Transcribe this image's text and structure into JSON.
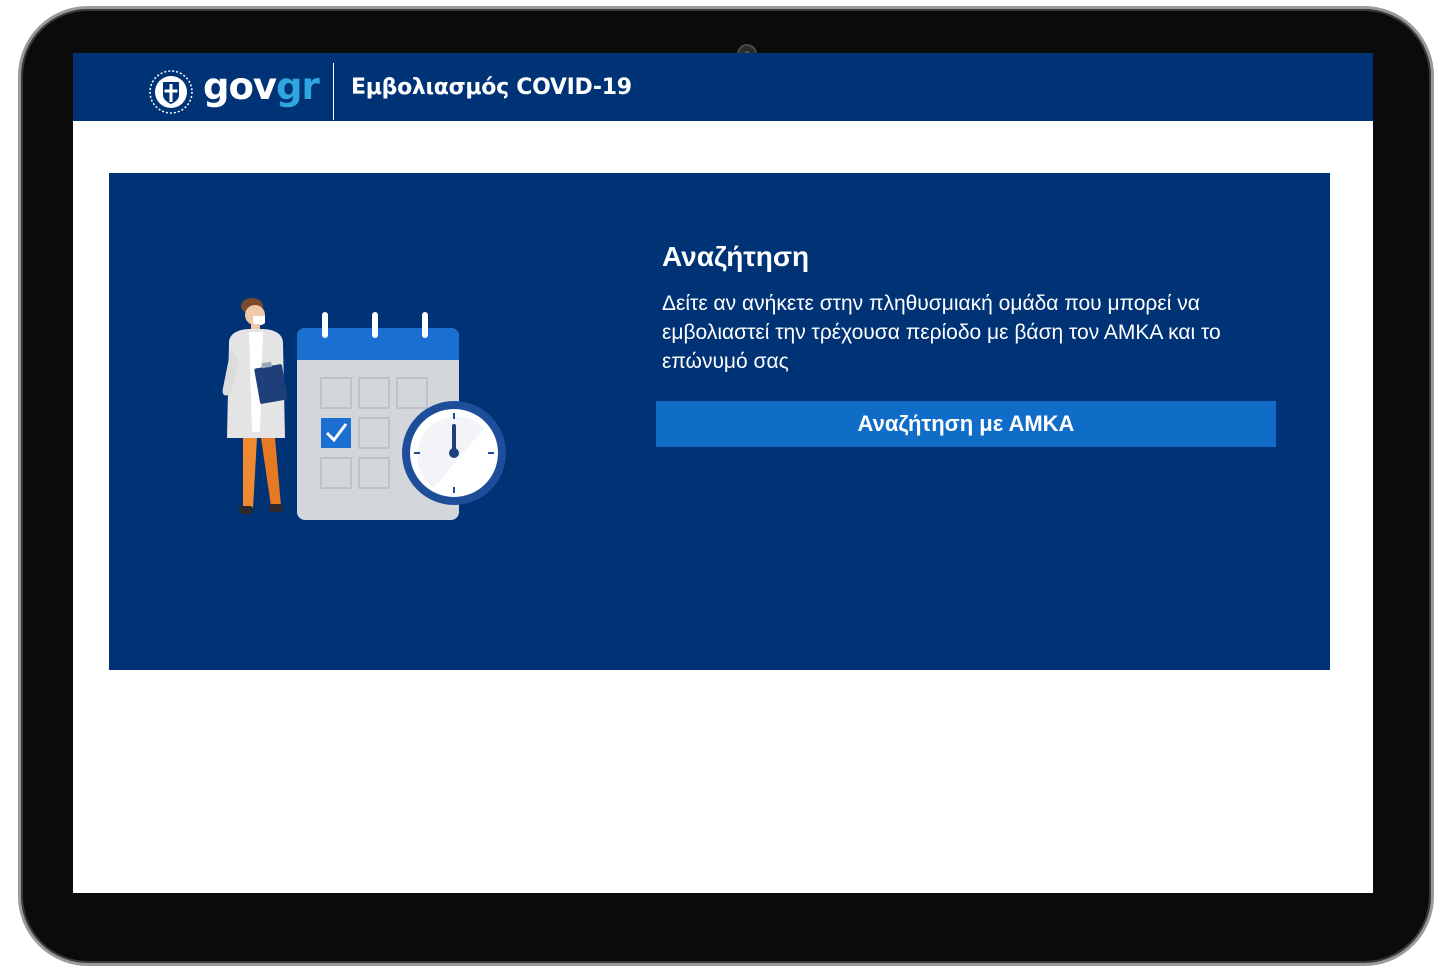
{
  "header": {
    "brand_gov": "gov",
    "brand_gr": "gr",
    "service_name": "Εμβολιασμός COVID-19",
    "emblem_icon": "hellenic-emblem-icon",
    "background_color": "#003375",
    "brand_accent_color": "#2fa6e0"
  },
  "panel": {
    "title": "Αναζήτηση",
    "description": "Δείτε αν ανήκετε στην πληθυσμιακή ομάδα που μπορεί να εμβολιαστεί την τρέχουσα περίοδο με βάση τον ΑΜΚΑ και το επώνυμό σας",
    "button_label": "Αναζήτηση με ΑΜΚΑ",
    "illustration_icons": [
      "doctor-icon",
      "calendar-icon",
      "clock-icon"
    ],
    "background_color": "#003375",
    "button_color": "#0f6cc7"
  }
}
